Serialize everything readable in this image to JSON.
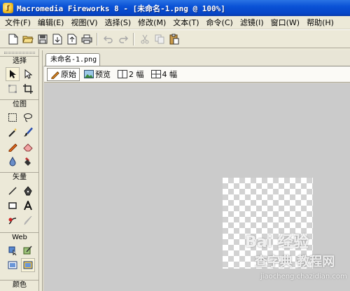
{
  "window": {
    "title": "Macromedia Fireworks 8 - [未命名-1.png @ 100%]",
    "app_icon": "fireworks-icon"
  },
  "menu": [
    "文件(F)",
    "编辑(E)",
    "视图(V)",
    "选择(S)",
    "修改(M)",
    "文本(T)",
    "命令(C)",
    "滤镜(I)",
    "窗口(W)",
    "帮助(H)"
  ],
  "toolbar": {
    "icons": [
      "new-document-icon",
      "open-folder-icon",
      "save-icon",
      "import-icon",
      "export-icon",
      "print-icon",
      "undo-icon",
      "redo-icon",
      "cut-icon",
      "copy-icon",
      "paste-icon"
    ]
  },
  "tools": {
    "sections": {
      "select": "选择",
      "bitmap": "位图",
      "vector": "矢量",
      "web": "Web",
      "colors": "颜色"
    },
    "icons": [
      "pointer-icon",
      "subselection-icon",
      "scale-icon",
      "crop-icon",
      "marquee-icon",
      "lasso-icon",
      "magic-wand-icon",
      "brush-icon",
      "pencil-icon",
      "eraser-icon",
      "blur-icon",
      "rubber-stamp-icon",
      "line-icon",
      "pen-icon",
      "rectangle-icon",
      "text-icon",
      "freeform-icon",
      "knife-icon",
      "hotspot-icon",
      "slice-icon",
      "hide-slices-icon",
      "show-slices-icon"
    ]
  },
  "document": {
    "tab": "未命名-1.png",
    "views": {
      "original": "原始",
      "preview": "预览",
      "two_up": "2 幅",
      "four_up": "4 幅"
    },
    "active_view": "original"
  },
  "watermark": {
    "logo": "Bai 经验",
    "site_cn": "查字典 教程网",
    "url": "jiaocheng.chazidian.com"
  },
  "colors": {
    "titlebar": "#0a52d6",
    "canvas_bg": "#cbcbcb",
    "chrome": "#ece9d8"
  }
}
